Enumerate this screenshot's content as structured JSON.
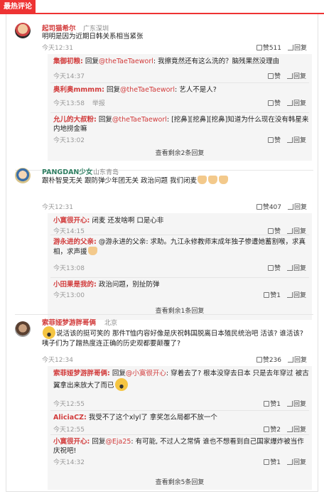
{
  "tab": "最热评论",
  "comments": [
    {
      "user": "起司猫希尔",
      "location": "广东深圳",
      "text": "明明是因为近期日韩关系相当紧张",
      "time": "今天12:31",
      "likes": "赞511",
      "reply": "回复",
      "replies": [
        {
          "user": "集御初粮:",
          "reply_word": "回复",
          "mention": "@theTaeTaeworl",
          "text": ": 我擦竟然还有这么洗的？脑残果然没理由",
          "time": "今天14:37",
          "likes": "赞",
          "reply": "回复"
        },
        {
          "user": "奥利奥mmmm:",
          "reply_word": "回复",
          "mention": "@theTaeTaeworl",
          "text": ": 艺人不是人?",
          "time": "今天13:58",
          "report": "举报",
          "likes": "赞",
          "reply": "回复"
        },
        {
          "user": "允儿的大叔粉:",
          "reply_word": "回复",
          "mention": "@theTaeTaeworl",
          "text": ": [挖鼻][挖鼻][挖鼻]知道为什么现在没有韩星来内地捞金嘛",
          "time": "今天13:02",
          "likes": "赞",
          "reply": "回复"
        }
      ],
      "more": "查看剩余2条回复"
    },
    {
      "user": "PANGDAN少女",
      "location": "山东青岛",
      "text": "跟朴智旻无关 跟防弹少年团无关 政治问题 我们闭麦",
      "time": "今天12:31",
      "likes": "赞407",
      "reply": "回复",
      "replies": [
        {
          "user": "小寞很开心:",
          "text": " 闭麦 还发啥啊 口是心非",
          "time": "今天14:15",
          "likes": "赞",
          "reply": "回复"
        },
        {
          "user": "游永进的父亲:",
          "text": " @游永进的父亲: 求助。九江永修教师末成年独子惨遭她蓄割喉，求真相，求声援",
          "time": "今天13:08",
          "likes": "赞",
          "reply": "回复"
        },
        {
          "user": "小田果是我的:",
          "text": " 政治问题，别扯防弹",
          "time": "今天13:00",
          "likes": "赞1",
          "reply": "回复"
        }
      ],
      "more": "查看剩余1条回复"
    },
    {
      "user": "索菲娅梦游胖哥俩",
      "location": "北京",
      "text": "说活该的挺可笑的 那件T恤内容好像是庆祝韩国脱离日本殖民统治吧 活该? 谁活该? 咦子们为了蹭热度连正确的历史观都要颠覆了?",
      "time": "今天12:34",
      "likes": "赞236",
      "reply": "回复",
      "replies": [
        {
          "user": "索菲娅梦游胖哥俩:",
          "reply_word": "回复",
          "mention": "@小寞很开心",
          "text": ": 穿着去了? 根本没穿去日本 只是去年穿过 被古翼拿出来放大了而已",
          "time": "今天12:55",
          "likes": "赞1",
          "reply": "回复"
        },
        {
          "user": "AliciaCZ:",
          "text": " 我受不了这个xlyl了 拿奖怎么局都不放一个",
          "time": "今天12:55",
          "likes": "赞2",
          "reply": "回复"
        },
        {
          "user": "小寞很开心:",
          "reply_word": "回复",
          "mention": "@Eja25",
          "text": ": 有可能, 不过人之常情 谁也不想看到自己国家爆炸被当作庆祝吧!",
          "time": "今天14:32",
          "likes": "赞1",
          "reply": "回复"
        }
      ],
      "more": "查看剩余5条回复"
    }
  ]
}
